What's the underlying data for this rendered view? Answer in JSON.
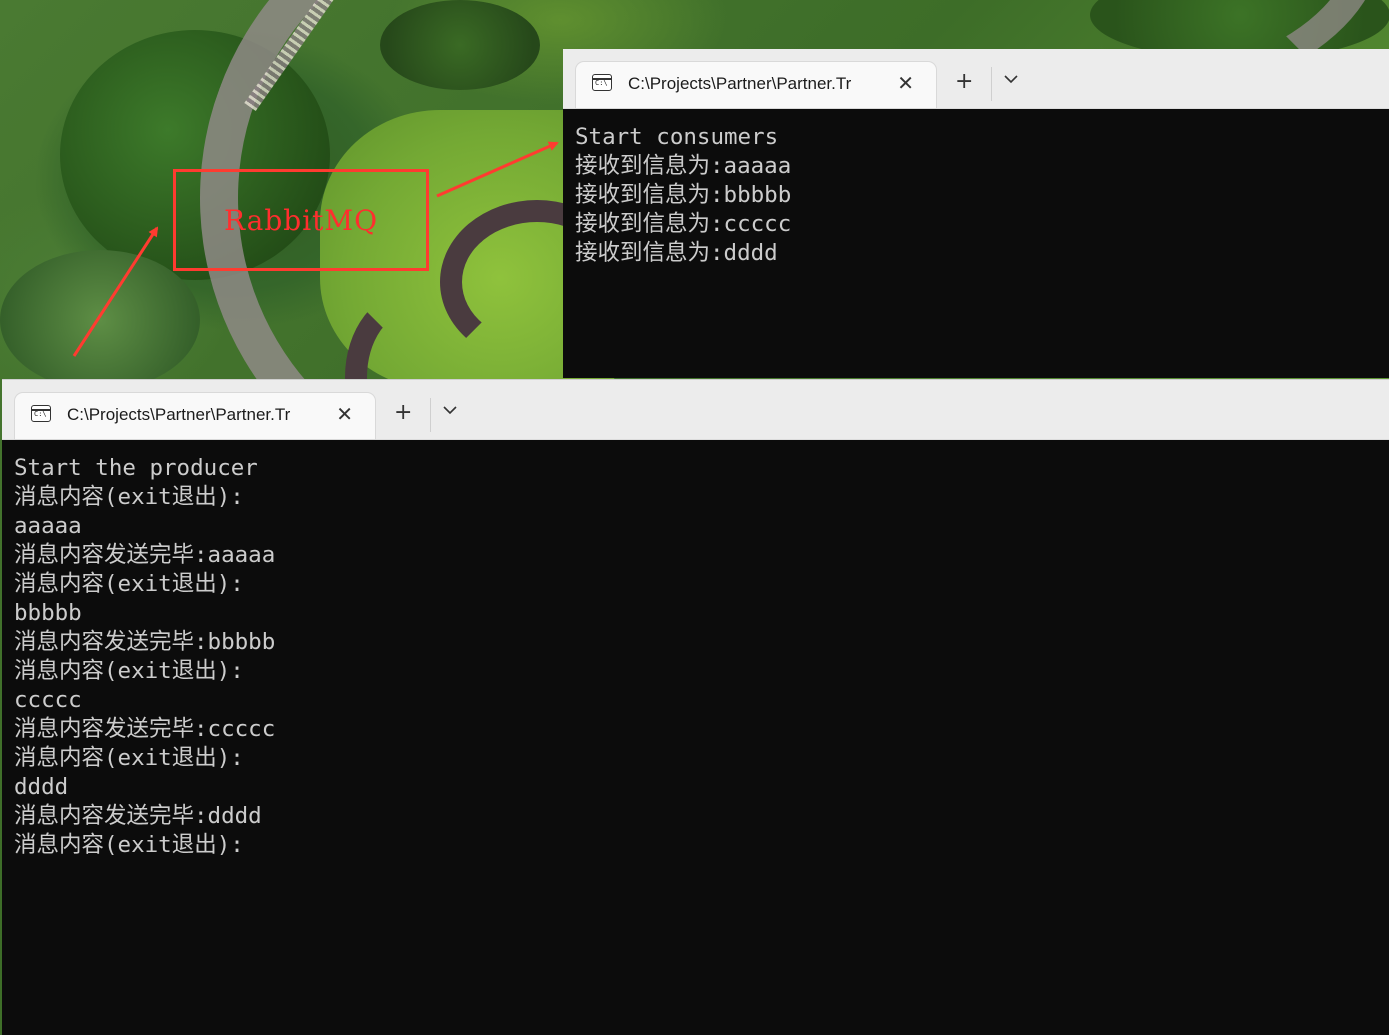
{
  "annotation": {
    "label": "RabbitMQ"
  },
  "consumer_window": {
    "tab_title": "C:\\Projects\\Partner\\Partner.Tr",
    "tab_icon": "terminal-icon",
    "close_icon": "close-icon",
    "new_tab_icon": "plus-icon",
    "dropdown_icon": "chevron-down-icon",
    "icon_text": "C:\\",
    "lines": [
      "Start consumers",
      "接收到信息为:aaaaa",
      "接收到信息为:bbbbb",
      "接收到信息为:ccccc",
      "接收到信息为:dddd"
    ]
  },
  "producer_window": {
    "tab_title": "C:\\Projects\\Partner\\Partner.Tr",
    "tab_icon": "terminal-icon",
    "close_icon": "close-icon",
    "new_tab_icon": "plus-icon",
    "dropdown_icon": "chevron-down-icon",
    "icon_text": "C:\\",
    "lines": [
      "Start the producer",
      "消息内容(exit退出):",
      "aaaaa",
      "消息内容发送完毕:aaaaa",
      "消息内容(exit退出):",
      "bbbbb",
      "消息内容发送完毕:bbbbb",
      "消息内容(exit退出):",
      "ccccc",
      "消息内容发送完毕:ccccc",
      "消息内容(exit退出):",
      "dddd",
      "消息内容发送完毕:dddd",
      "消息内容(exit退出):"
    ]
  },
  "colors": {
    "annotation": "#ff3b30",
    "console_bg": "#0c0c0c",
    "console_text": "#cccccc",
    "titlebar": "#ececec"
  }
}
